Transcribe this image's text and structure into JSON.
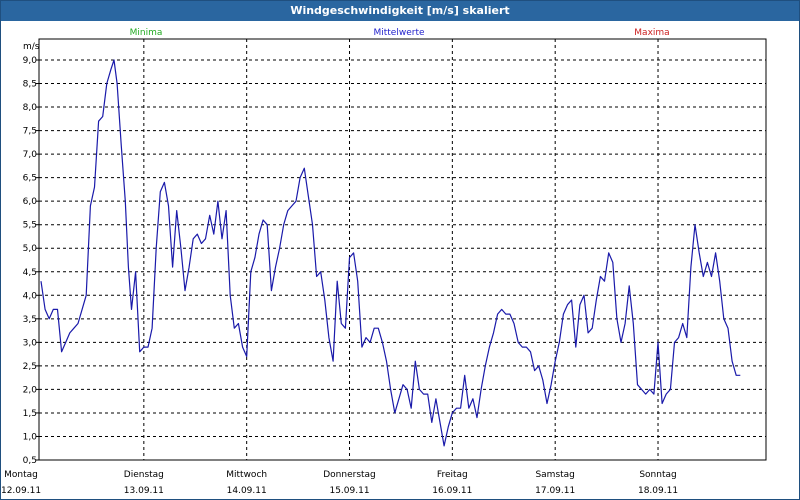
{
  "window": {
    "title": "Windgeschwindigkeit [m/s] skaliert"
  },
  "legend": [
    {
      "label": "Minima",
      "color": "#22aa22"
    },
    {
      "label": "Mittelwerte",
      "color": "#2222cc"
    },
    {
      "label": "Maxima",
      "color": "#cc2222"
    }
  ],
  "chart_data": {
    "type": "line",
    "title": "Windgeschwindigkeit [m/s] skaliert",
    "ylabel": "m/s",
    "ylim": [
      0.5,
      9.0
    ],
    "yticks": [
      "9,0",
      "8,5",
      "8,0",
      "7,5",
      "7,0",
      "6,5",
      "6,0",
      "5,5",
      "5,0",
      "4,5",
      "4,0",
      "3,5",
      "3,0",
      "2,5",
      "2,0",
      "1,5",
      "1,0",
      "0,5"
    ],
    "grid": true,
    "x_days": [
      {
        "day": "Montag",
        "date": "12.09.11"
      },
      {
        "day": "Dienstag",
        "date": "13.09.11"
      },
      {
        "day": "Mittwoch",
        "date": "14.09.11"
      },
      {
        "day": "Donnerstag",
        "date": "15.09.11"
      },
      {
        "day": "Freitag",
        "date": "16.09.11"
      },
      {
        "day": "Samstag",
        "date": "17.09.11"
      },
      {
        "day": "Sonntag",
        "date": "18.09.11"
      }
    ],
    "x_range_days": [
      0,
      7.05
    ],
    "series": [
      {
        "name": "Mittelwerte",
        "color": "#1a1aaa",
        "points": [
          [
            0.0,
            4.3
          ],
          [
            0.04,
            3.7
          ],
          [
            0.08,
            3.5
          ],
          [
            0.12,
            3.7
          ],
          [
            0.16,
            3.7
          ],
          [
            0.2,
            2.8
          ],
          [
            0.24,
            3.0
          ],
          [
            0.28,
            3.2
          ],
          [
            0.32,
            3.3
          ],
          [
            0.36,
            3.4
          ],
          [
            0.4,
            3.7
          ],
          [
            0.44,
            4.0
          ],
          [
            0.48,
            5.9
          ],
          [
            0.52,
            6.3
          ],
          [
            0.56,
            7.7
          ],
          [
            0.6,
            7.8
          ],
          [
            0.64,
            8.5
          ],
          [
            0.68,
            8.8
          ],
          [
            0.71,
            9.0
          ],
          [
            0.74,
            8.5
          ],
          [
            0.78,
            7.2
          ],
          [
            0.82,
            6.0
          ],
          [
            0.85,
            4.6
          ],
          [
            0.88,
            3.7
          ],
          [
            0.92,
            4.5
          ],
          [
            0.96,
            2.8
          ],
          [
            1.0,
            2.9
          ],
          [
            1.04,
            2.9
          ],
          [
            1.08,
            3.3
          ],
          [
            1.12,
            5.0
          ],
          [
            1.16,
            6.2
          ],
          [
            1.2,
            6.4
          ],
          [
            1.24,
            5.9
          ],
          [
            1.28,
            4.6
          ],
          [
            1.32,
            5.8
          ],
          [
            1.36,
            5.0
          ],
          [
            1.4,
            4.1
          ],
          [
            1.44,
            4.6
          ],
          [
            1.48,
            5.2
          ],
          [
            1.52,
            5.3
          ],
          [
            1.56,
            5.1
          ],
          [
            1.6,
            5.2
          ],
          [
            1.64,
            5.7
          ],
          [
            1.68,
            5.3
          ],
          [
            1.72,
            6.0
          ],
          [
            1.76,
            5.2
          ],
          [
            1.8,
            5.8
          ],
          [
            1.84,
            4.0
          ],
          [
            1.88,
            3.3
          ],
          [
            1.92,
            3.4
          ],
          [
            1.96,
            2.9
          ],
          [
            2.0,
            2.7
          ],
          [
            2.04,
            4.5
          ],
          [
            2.08,
            4.8
          ],
          [
            2.12,
            5.3
          ],
          [
            2.16,
            5.6
          ],
          [
            2.2,
            5.5
          ],
          [
            2.24,
            4.1
          ],
          [
            2.28,
            4.6
          ],
          [
            2.32,
            5.0
          ],
          [
            2.36,
            5.5
          ],
          [
            2.4,
            5.8
          ],
          [
            2.44,
            5.9
          ],
          [
            2.48,
            6.0
          ],
          [
            2.52,
            6.5
          ],
          [
            2.56,
            6.7
          ],
          [
            2.6,
            6.1
          ],
          [
            2.64,
            5.5
          ],
          [
            2.68,
            4.4
          ],
          [
            2.72,
            4.5
          ],
          [
            2.76,
            3.9
          ],
          [
            2.8,
            3.1
          ],
          [
            2.84,
            2.6
          ],
          [
            2.88,
            4.3
          ],
          [
            2.92,
            3.4
          ],
          [
            2.96,
            3.3
          ],
          [
            3.0,
            4.8
          ],
          [
            3.04,
            4.9
          ],
          [
            3.08,
            4.3
          ],
          [
            3.12,
            2.9
          ],
          [
            3.16,
            3.1
          ],
          [
            3.2,
            3.0
          ],
          [
            3.24,
            3.3
          ],
          [
            3.28,
            3.3
          ],
          [
            3.32,
            3.0
          ],
          [
            3.36,
            2.6
          ],
          [
            3.4,
            2.0
          ],
          [
            3.44,
            1.5
          ],
          [
            3.48,
            1.8
          ],
          [
            3.52,
            2.1
          ],
          [
            3.56,
            2.0
          ],
          [
            3.6,
            1.6
          ],
          [
            3.64,
            2.6
          ],
          [
            3.68,
            2.0
          ],
          [
            3.72,
            1.9
          ],
          [
            3.76,
            1.9
          ],
          [
            3.8,
            1.3
          ],
          [
            3.84,
            1.8
          ],
          [
            3.88,
            1.3
          ],
          [
            3.92,
            0.8
          ],
          [
            3.96,
            1.2
          ],
          [
            4.0,
            1.5
          ],
          [
            4.04,
            1.6
          ],
          [
            4.08,
            1.6
          ],
          [
            4.12,
            2.3
          ],
          [
            4.16,
            1.6
          ],
          [
            4.2,
            1.8
          ],
          [
            4.24,
            1.4
          ],
          [
            4.28,
            2.0
          ],
          [
            4.32,
            2.5
          ],
          [
            4.36,
            2.9
          ],
          [
            4.4,
            3.2
          ],
          [
            4.44,
            3.6
          ],
          [
            4.48,
            3.7
          ],
          [
            4.52,
            3.6
          ],
          [
            4.56,
            3.6
          ],
          [
            4.6,
            3.4
          ],
          [
            4.64,
            3.0
          ],
          [
            4.68,
            2.9
          ],
          [
            4.72,
            2.9
          ],
          [
            4.76,
            2.8
          ],
          [
            4.8,
            2.4
          ],
          [
            4.84,
            2.5
          ],
          [
            4.88,
            2.2
          ],
          [
            4.92,
            1.7
          ],
          [
            4.96,
            2.1
          ],
          [
            5.0,
            2.6
          ],
          [
            5.04,
            3.0
          ],
          [
            5.08,
            3.6
          ],
          [
            5.12,
            3.8
          ],
          [
            5.16,
            3.9
          ],
          [
            5.2,
            2.9
          ],
          [
            5.24,
            3.8
          ],
          [
            5.28,
            4.0
          ],
          [
            5.32,
            3.2
          ],
          [
            5.36,
            3.3
          ],
          [
            5.4,
            3.9
          ],
          [
            5.44,
            4.4
          ],
          [
            5.48,
            4.3
          ],
          [
            5.52,
            4.9
          ],
          [
            5.56,
            4.7
          ],
          [
            5.6,
            3.5
          ],
          [
            5.64,
            3.0
          ],
          [
            5.68,
            3.4
          ],
          [
            5.72,
            4.2
          ],
          [
            5.76,
            3.4
          ],
          [
            5.8,
            2.1
          ],
          [
            5.84,
            2.0
          ],
          [
            5.88,
            1.9
          ],
          [
            5.92,
            2.0
          ],
          [
            5.96,
            1.9
          ],
          [
            6.0,
            3.0
          ],
          [
            6.04,
            1.7
          ],
          [
            6.08,
            1.9
          ],
          [
            6.12,
            2.0
          ],
          [
            6.16,
            3.0
          ],
          [
            6.2,
            3.1
          ],
          [
            6.24,
            3.4
          ],
          [
            6.28,
            3.1
          ],
          [
            6.32,
            4.6
          ],
          [
            6.36,
            5.5
          ],
          [
            6.4,
            4.9
          ],
          [
            6.44,
            4.4
          ],
          [
            6.48,
            4.7
          ],
          [
            6.52,
            4.4
          ],
          [
            6.56,
            4.9
          ],
          [
            6.6,
            4.3
          ],
          [
            6.64,
            3.5
          ],
          [
            6.68,
            3.3
          ],
          [
            6.72,
            2.6
          ],
          [
            6.76,
            2.3
          ],
          [
            6.8,
            2.3
          ]
        ]
      }
    ]
  }
}
